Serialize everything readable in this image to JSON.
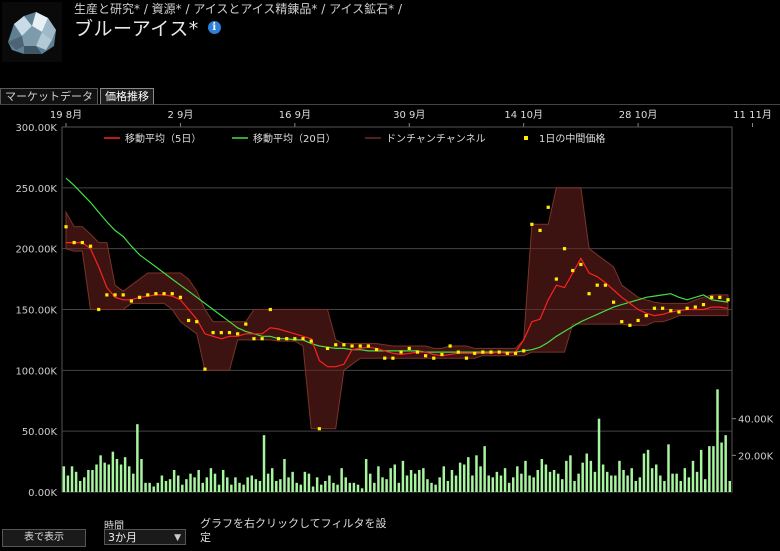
{
  "header": {
    "breadcrumb": "生産と研究* / 資源* / アイスとアイス精錬品* / アイス鉱石* /",
    "title": "ブルーアイス*",
    "info_icon": "info-icon",
    "item_icon": "blue-ice-icon"
  },
  "tabs": [
    {
      "label": "マーケットデータ",
      "active": false
    },
    {
      "label": "価格推移",
      "active": true
    }
  ],
  "footer": {
    "table_button": "表で表示",
    "time_label": "時間",
    "time_value": "3か月",
    "filter_hint": "グラフを右クリックしてフィルタを設定"
  },
  "colors": {
    "ma5": "#ff2020",
    "ma20": "#44dd44",
    "donchian": "#6a2a22",
    "median": "#ffee00",
    "volume": "#a8f5a0",
    "grid": "#444444"
  },
  "chart_data": {
    "type": "line",
    "date_labels": [
      "19 8月",
      "2 9月",
      "16 9月",
      "30 9月",
      "14 10月",
      "28 10月",
      "11 11月"
    ],
    "date_label_days": [
      0,
      14,
      28,
      42,
      56,
      70,
      84
    ],
    "legend": [
      "移動平均（5日）",
      "移動平均（20日）",
      "ドンチャンチャンネル",
      "1日の中間価格"
    ],
    "y_ticks": [
      "0.00K",
      "50.00K",
      "100.00K",
      "150.00K",
      "200.00K",
      "250.00K",
      "300.00K"
    ],
    "ylim": [
      0,
      300000
    ],
    "volume_ticks": [
      "20.00K",
      "40.00K"
    ],
    "volume_lim": [
      0,
      60000
    ],
    "median": [
      218000,
      205000,
      205000,
      202000,
      150000,
      162000,
      162000,
      162000,
      157000,
      160000,
      162000,
      163000,
      163000,
      163000,
      160000,
      141000,
      140000,
      101000,
      131000,
      131000,
      131000,
      130000,
      138000,
      126000,
      126000,
      150000,
      126000,
      126000,
      126000,
      126000,
      124000,
      52000,
      118000,
      121000,
      121000,
      120000,
      120000,
      120000,
      117000,
      110000,
      110000,
      115000,
      118000,
      115000,
      112000,
      110000,
      113000,
      120000,
      115000,
      110000,
      114000,
      115000,
      115000,
      115000,
      114000,
      114000,
      116000,
      220000,
      215000,
      234000,
      175000,
      200000,
      182000,
      187000,
      163000,
      170000,
      170000,
      156000,
      140000,
      137000,
      141000,
      145000,
      151000,
      151000,
      149000,
      148000,
      151000,
      152000,
      154000,
      160000,
      160000,
      158000
    ],
    "ma5": [
      205000,
      205000,
      205000,
      200000,
      185000,
      168000,
      160000,
      158000,
      158000,
      160000,
      161000,
      162000,
      162000,
      161000,
      158000,
      150000,
      142000,
      130000,
      128000,
      126000,
      128000,
      128000,
      130000,
      130000,
      130000,
      135000,
      134000,
      132000,
      130000,
      128000,
      126000,
      108000,
      103000,
      103000,
      105000,
      117000,
      118000,
      119000,
      118000,
      116000,
      114000,
      113000,
      114000,
      115000,
      115000,
      113000,
      112000,
      113000,
      114000,
      114000,
      114000,
      114000,
      114000,
      115000,
      114000,
      115000,
      125000,
      140000,
      142000,
      158000,
      170000,
      168000,
      180000,
      192000,
      180000,
      177000,
      172000,
      166000,
      160000,
      155000,
      150000,
      147000,
      145000,
      146000,
      148000,
      149000,
      150000,
      150000,
      150000,
      152000,
      152000,
      151000
    ],
    "ma20": [
      258000,
      252000,
      245000,
      238000,
      230000,
      222000,
      215000,
      210000,
      202000,
      195000,
      190000,
      185000,
      180000,
      175000,
      170000,
      165000,
      160000,
      155000,
      150000,
      145000,
      140000,
      135000,
      132000,
      130000,
      128000,
      128000,
      126000,
      126000,
      125000,
      125000,
      122000,
      120000,
      119000,
      118000,
      118000,
      117000,
      117000,
      116000,
      116000,
      116000,
      116000,
      116000,
      116000,
      116000,
      115000,
      115000,
      115000,
      115000,
      115000,
      115000,
      115000,
      115000,
      115000,
      115000,
      115000,
      115000,
      116000,
      117000,
      119000,
      123000,
      128000,
      132000,
      136000,
      140000,
      143000,
      146000,
      149000,
      152000,
      154000,
      156000,
      158000,
      160000,
      161000,
      162000,
      163000,
      160000,
      158000,
      160000,
      162000,
      158000,
      157000,
      156000
    ],
    "donchian_high": [
      230000,
      218000,
      218000,
      212000,
      205000,
      205000,
      170000,
      165000,
      170000,
      175000,
      180000,
      180000,
      180000,
      180000,
      180000,
      175000,
      165000,
      150000,
      140000,
      140000,
      140000,
      140000,
      140000,
      150000,
      150000,
      150000,
      150000,
      150000,
      150000,
      150000,
      150000,
      150000,
      150000,
      125000,
      122000,
      122000,
      122000,
      122000,
      122000,
      121000,
      120000,
      120000,
      120000,
      120000,
      120000,
      118000,
      118000,
      120000,
      120000,
      120000,
      118000,
      118000,
      118000,
      118000,
      118000,
      118000,
      125000,
      220000,
      220000,
      220000,
      250000,
      250000,
      250000,
      250000,
      200000,
      195000,
      190000,
      185000,
      170000,
      165000,
      160000,
      158000,
      156000,
      155000,
      155000,
      155000,
      155000,
      158000,
      160000,
      162000,
      162000,
      162000
    ],
    "donchian_low": [
      200000,
      198000,
      198000,
      150000,
      150000,
      150000,
      150000,
      150000,
      155000,
      155000,
      155000,
      155000,
      155000,
      150000,
      140000,
      135000,
      130000,
      100000,
      100000,
      100000,
      100000,
      125000,
      125000,
      125000,
      125000,
      125000,
      124000,
      124000,
      124000,
      120000,
      52000,
      52000,
      52000,
      52000,
      100000,
      105000,
      110000,
      110000,
      110000,
      110000,
      110000,
      110000,
      110000,
      110000,
      110000,
      110000,
      110000,
      110000,
      110000,
      110000,
      110000,
      112000,
      112000,
      112000,
      112000,
      112000,
      112000,
      115000,
      115000,
      115000,
      115000,
      115000,
      138000,
      138000,
      138000,
      138000,
      138000,
      138000,
      138000,
      137000,
      137000,
      137000,
      140000,
      140000,
      142000,
      145000,
      145000,
      145000,
      145000,
      145000,
      145000,
      145000
    ],
    "volume": [
      14000,
      9000,
      14000,
      11000,
      6000,
      8000,
      12000,
      12000,
      15000,
      20000,
      16000,
      15000,
      22000,
      18000,
      15000,
      19000,
      14000,
      10000,
      37000,
      18000,
      5000,
      5000,
      3000,
      5000,
      9000,
      6000,
      7000,
      12000,
      9000,
      4000,
      7000,
      10000,
      8000,
      12000,
      5000,
      8000,
      13000,
      10000,
      4000,
      12000,
      8000,
      4000,
      8000,
      5000,
      4000,
      8000,
      9000,
      7000,
      6000,
      31000,
      10000,
      13000,
      6000,
      7000,
      18000,
      8000,
      11000,
      5000,
      4000,
      11000,
      10000,
      3000,
      8000,
      4000,
      6000,
      9000,
      5000,
      4000,
      13000,
      8000,
      5000,
      5000,
      4000,
      2000,
      18000,
      10000,
      5000,
      14000,
      8000,
      7000,
      13000,
      15000,
      5000,
      17000,
      9000,
      12000,
      10000,
      12000,
      13000,
      7000,
      5000,
      4000,
      8000,
      14000,
      6000,
      12000,
      9000,
      16000,
      15000,
      19000,
      9000,
      20000,
      14000,
      25000,
      9000,
      8000,
      11000,
      9000,
      13000,
      5000,
      8000,
      14000,
      10000,
      17000,
      9000,
      8000,
      12000,
      18000,
      15000,
      11000,
      12000,
      10000,
      7000,
      17000,
      20000,
      6000,
      10000,
      16000,
      21000,
      17000,
      11000,
      40000,
      15000,
      11000,
      9000,
      9000,
      17000,
      12000,
      9000,
      13000,
      6000,
      8000,
      21000,
      23000,
      13000,
      15000,
      9000,
      6000,
      26000,
      10000,
      10000,
      6000,
      13000,
      8000,
      17000,
      11000,
      23000,
      7000,
      25000,
      25000,
      56000,
      27000,
      31000,
      6000
    ]
  }
}
